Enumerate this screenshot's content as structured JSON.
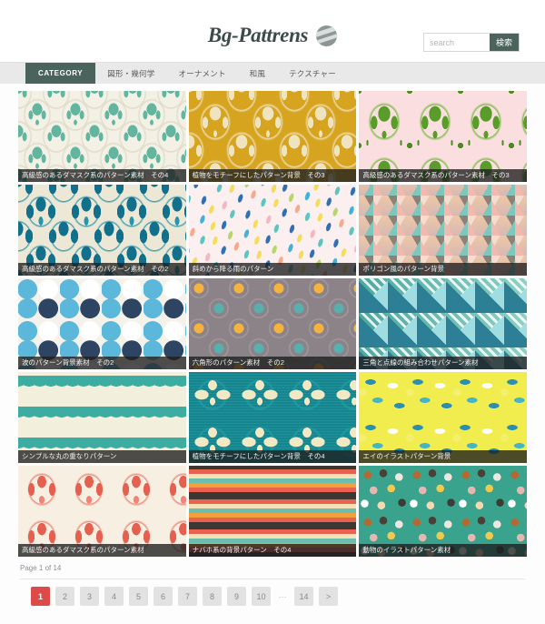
{
  "site": {
    "logo_text": "Bg-Pattrens",
    "logo_icon": "wave-circle-icon"
  },
  "search": {
    "placeholder": "search",
    "value": "",
    "button_label": "検索"
  },
  "nav": {
    "items": [
      {
        "label": "CATEGORY",
        "active": true
      },
      {
        "label": "図形・幾何学",
        "active": false
      },
      {
        "label": "オーナメント",
        "active": false
      },
      {
        "label": "和風",
        "active": false
      },
      {
        "label": "テクスチャー",
        "active": false
      }
    ]
  },
  "gallery": {
    "cards": [
      {
        "caption": "高級感のあるダマスク系のパターン素材　その4",
        "pattern": "p-damask-teal"
      },
      {
        "caption": "植物をモチーフにしたパターン背景　その3",
        "pattern": "p-damask-gold"
      },
      {
        "caption": "高級感のあるダマスク系のパターン素材　その3",
        "pattern": "p-damask-green"
      },
      {
        "caption": "高級感のあるダマスク系のパターン素材　その2",
        "pattern": "p-damask-deepteal"
      },
      {
        "caption": "斜めから降る雨のパターン",
        "pattern": "p-rain"
      },
      {
        "caption": "ポリゴン風のパターン背景",
        "pattern": "p-poly"
      },
      {
        "caption": "波のパターン背景素材　その2",
        "pattern": "p-wave"
      },
      {
        "caption": "六角形のパターン素材　その2",
        "pattern": "p-hex"
      },
      {
        "caption": "三角と点線の組み合わせパターン素材",
        "pattern": "p-tri"
      },
      {
        "caption": "シンプルな丸の重なりパターン",
        "pattern": "p-scallop"
      },
      {
        "caption": "植物をモチーフにしたパターン背景　その4",
        "pattern": "p-damask-cream"
      },
      {
        "caption": "エイのイラストパターン背景",
        "pattern": "p-ray"
      },
      {
        "caption": "高級感のあるダマスク系のパターン素材",
        "pattern": "p-damask-red"
      },
      {
        "caption": "ナバホ系の背景パターン　その4",
        "pattern": "p-navajo"
      },
      {
        "caption": "動物のイラストパターン素材",
        "pattern": "p-animal"
      }
    ]
  },
  "pagination": {
    "status": "Page 1 of 14",
    "current_page": 1,
    "total_pages": 14,
    "items": [
      {
        "label": "1",
        "active": true,
        "type": "page"
      },
      {
        "label": "2",
        "active": false,
        "type": "page"
      },
      {
        "label": "3",
        "active": false,
        "type": "page"
      },
      {
        "label": "4",
        "active": false,
        "type": "page"
      },
      {
        "label": "5",
        "active": false,
        "type": "page"
      },
      {
        "label": "6",
        "active": false,
        "type": "page"
      },
      {
        "label": "7",
        "active": false,
        "type": "page"
      },
      {
        "label": "8",
        "active": false,
        "type": "page"
      },
      {
        "label": "9",
        "active": false,
        "type": "page"
      },
      {
        "label": "10",
        "active": false,
        "type": "page"
      },
      {
        "label": "···",
        "active": false,
        "type": "ellipsis"
      },
      {
        "label": "14",
        "active": false,
        "type": "page"
      },
      {
        "label": ">",
        "active": false,
        "type": "next"
      }
    ]
  },
  "colors": {
    "accent_green": "#4a635c",
    "active_page_red": "#dc4b49",
    "nav_bg": "#e9e9e9",
    "caption_bg": "rgba(30,30,30,0.78)"
  }
}
